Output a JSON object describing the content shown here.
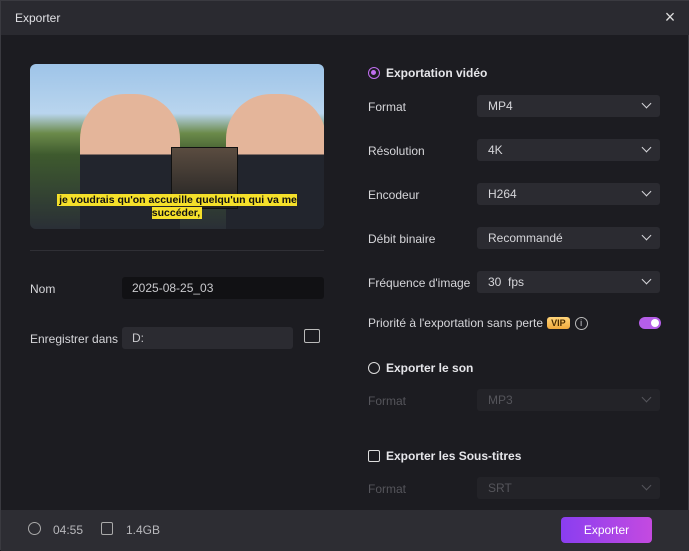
{
  "title": "Exporter",
  "preview": {
    "caption": "je voudrais qu'on accueille quelqu'un qui va me succéder,"
  },
  "name": {
    "label": "Nom",
    "value": "2025-08-25_03"
  },
  "save": {
    "label": "Enregistrer dans",
    "value": "D:"
  },
  "video": {
    "title": "Exportation vidéo",
    "format": {
      "label": "Format",
      "value": "MP4"
    },
    "resolution": {
      "label": "Résolution",
      "value": "4K"
    },
    "encoder": {
      "label": "Encodeur",
      "value": "H264"
    },
    "bitrate": {
      "label": "Débit binaire",
      "value": "Recommandé"
    },
    "framerate": {
      "label": "Fréquence d'image",
      "value": "30  fps"
    },
    "lossless": {
      "label": "Priorité à l'exportation sans perte",
      "badge": "VIP",
      "info": "i",
      "enabled": true
    }
  },
  "audio": {
    "title": "Exporter le son",
    "format_label": "Format",
    "format_value": "MP3"
  },
  "subtitles": {
    "title": "Exporter les Sous-titres",
    "format_label": "Format",
    "format_value": "SRT"
  },
  "footer": {
    "duration": "04:55",
    "size": "1.4GB",
    "export_label": "Exporter"
  },
  "colors": {
    "accent": "#b55ee8",
    "vip": "#f0a93c"
  }
}
